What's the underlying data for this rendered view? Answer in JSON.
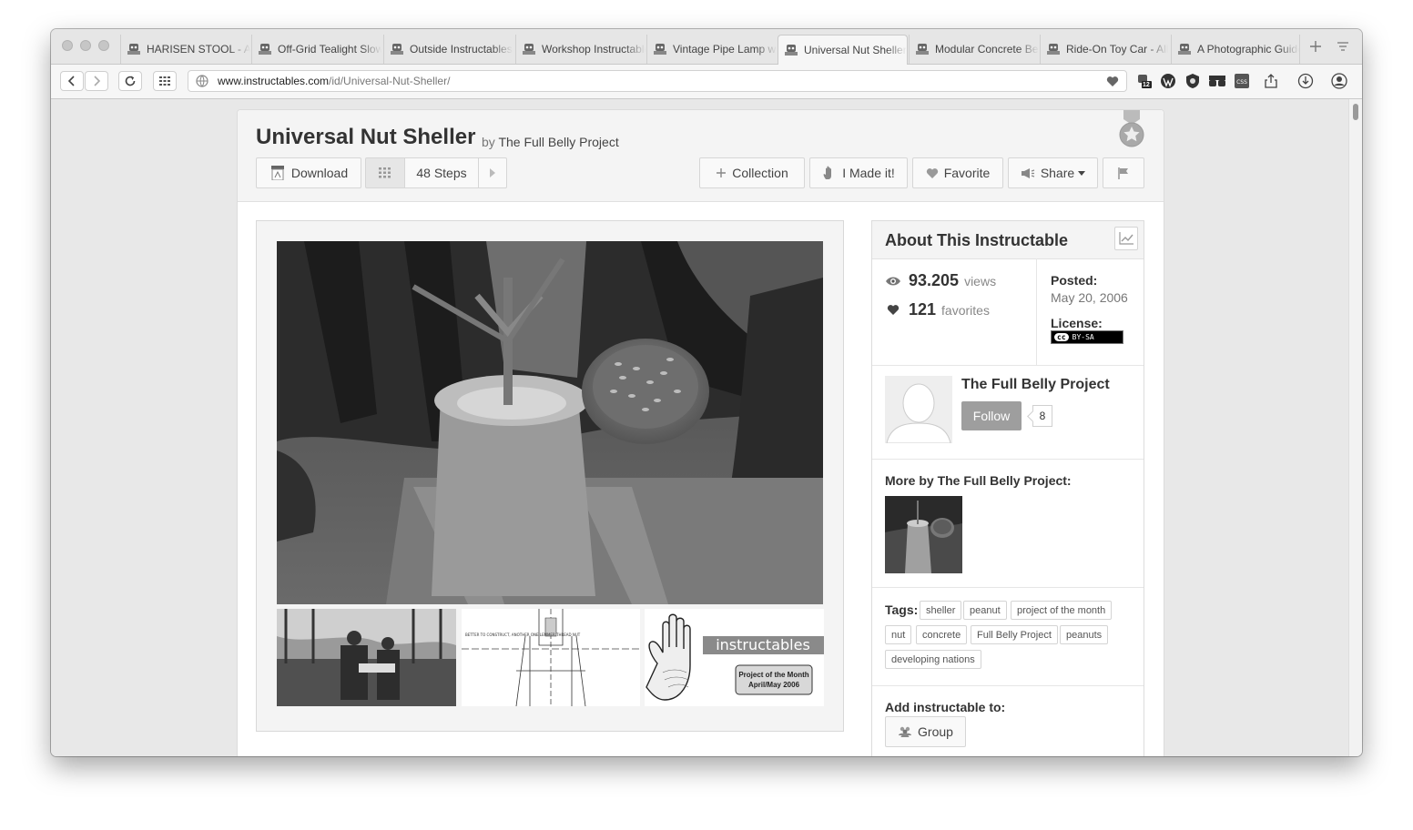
{
  "browser": {
    "tabs": [
      {
        "title": "HARISEN STOOL - All"
      },
      {
        "title": "Off-Grid Tealight Slow"
      },
      {
        "title": "Outside Instructables"
      },
      {
        "title": "Workshop Instructables"
      },
      {
        "title": "Vintage Pipe Lamp with"
      },
      {
        "title": "Universal Nut Sheller"
      },
      {
        "title": "Modular Concrete Bench"
      },
      {
        "title": "Ride-On Toy Car - All"
      },
      {
        "title": "A Photographic Guide"
      }
    ],
    "active_tab_index": 5,
    "url": {
      "host": "www.instructables.com",
      "path": "/id/Universal-Nut-Sheller/"
    },
    "extension_badge": "12"
  },
  "instructable": {
    "title": "Universal Nut Sheller",
    "by_label": "by",
    "author": "The Full Belly Project",
    "buttons": {
      "download": "Download",
      "steps": "48 Steps",
      "collection": "Collection",
      "made_it": "I Made it!",
      "favorite": "Favorite",
      "share": "Share"
    },
    "thumbnails": {
      "diagram_caption": "BETTER TO CONSTRUCT, ANOTHER ONE LEMMER THREAD NUT",
      "logo_text": "instructables",
      "award_line1": "Project of the Month",
      "award_line2": "April/May 2006"
    }
  },
  "about": {
    "heading": "About This Instructable",
    "views_count": "93.205",
    "views_label": "views",
    "favorites_count": "121",
    "favorites_label": "favorites",
    "posted_label": "Posted:",
    "posted_date": "May 20, 2006",
    "license_label": "License:",
    "license_badge": "BY-SA",
    "author_name": "The Full Belly Project",
    "follow_label": "Follow",
    "follower_count": "8",
    "more_by_label": "More by The Full Belly Project:",
    "tags_label": "Tags:",
    "tags": [
      "sheller",
      "peanut",
      "project of the month",
      "nut",
      "concrete",
      "Full Belly Project",
      "peanuts",
      "developing nations"
    ],
    "add_to_label": "Add instructable to:",
    "group_label": "Group"
  }
}
